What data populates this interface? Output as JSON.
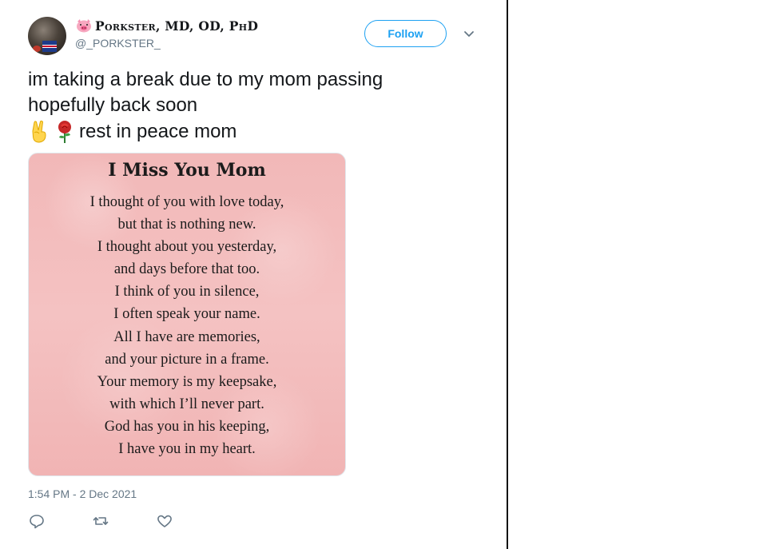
{
  "user": {
    "display_name": "Porkster, MD, OD, PhD",
    "handle": "@_PORKSTER_",
    "name_emoji": "pig-face-icon"
  },
  "follow_label": "Follow",
  "tweet": {
    "line1": "im taking a break due to my mom passing",
    "line2": "hopefully back soon",
    "line3": "rest in peace mom",
    "emojis": [
      "victory-hand-icon",
      "rose-icon"
    ]
  },
  "media": {
    "title": "I Miss You Mom",
    "lines": [
      "I thought of you with love today,",
      "but that is nothing new.",
      "I thought about you yesterday,",
      "and days before that too.",
      "I think of you in silence,",
      "I often speak your name.",
      "All I have are memories,",
      "and your picture in a frame.",
      "Your memory is my keepsake,",
      "with which I’ll never part.",
      "God has you in his keeping,",
      "I have you in my heart."
    ]
  },
  "timestamp": "1:54 PM - 2 Dec 2021",
  "actions": [
    "reply-icon",
    "retweet-icon",
    "like-icon"
  ],
  "colors": {
    "accent": "#1da1f2",
    "text": "#14171a",
    "secondary": "#657786",
    "card_pink": "#f4c2c2"
  }
}
